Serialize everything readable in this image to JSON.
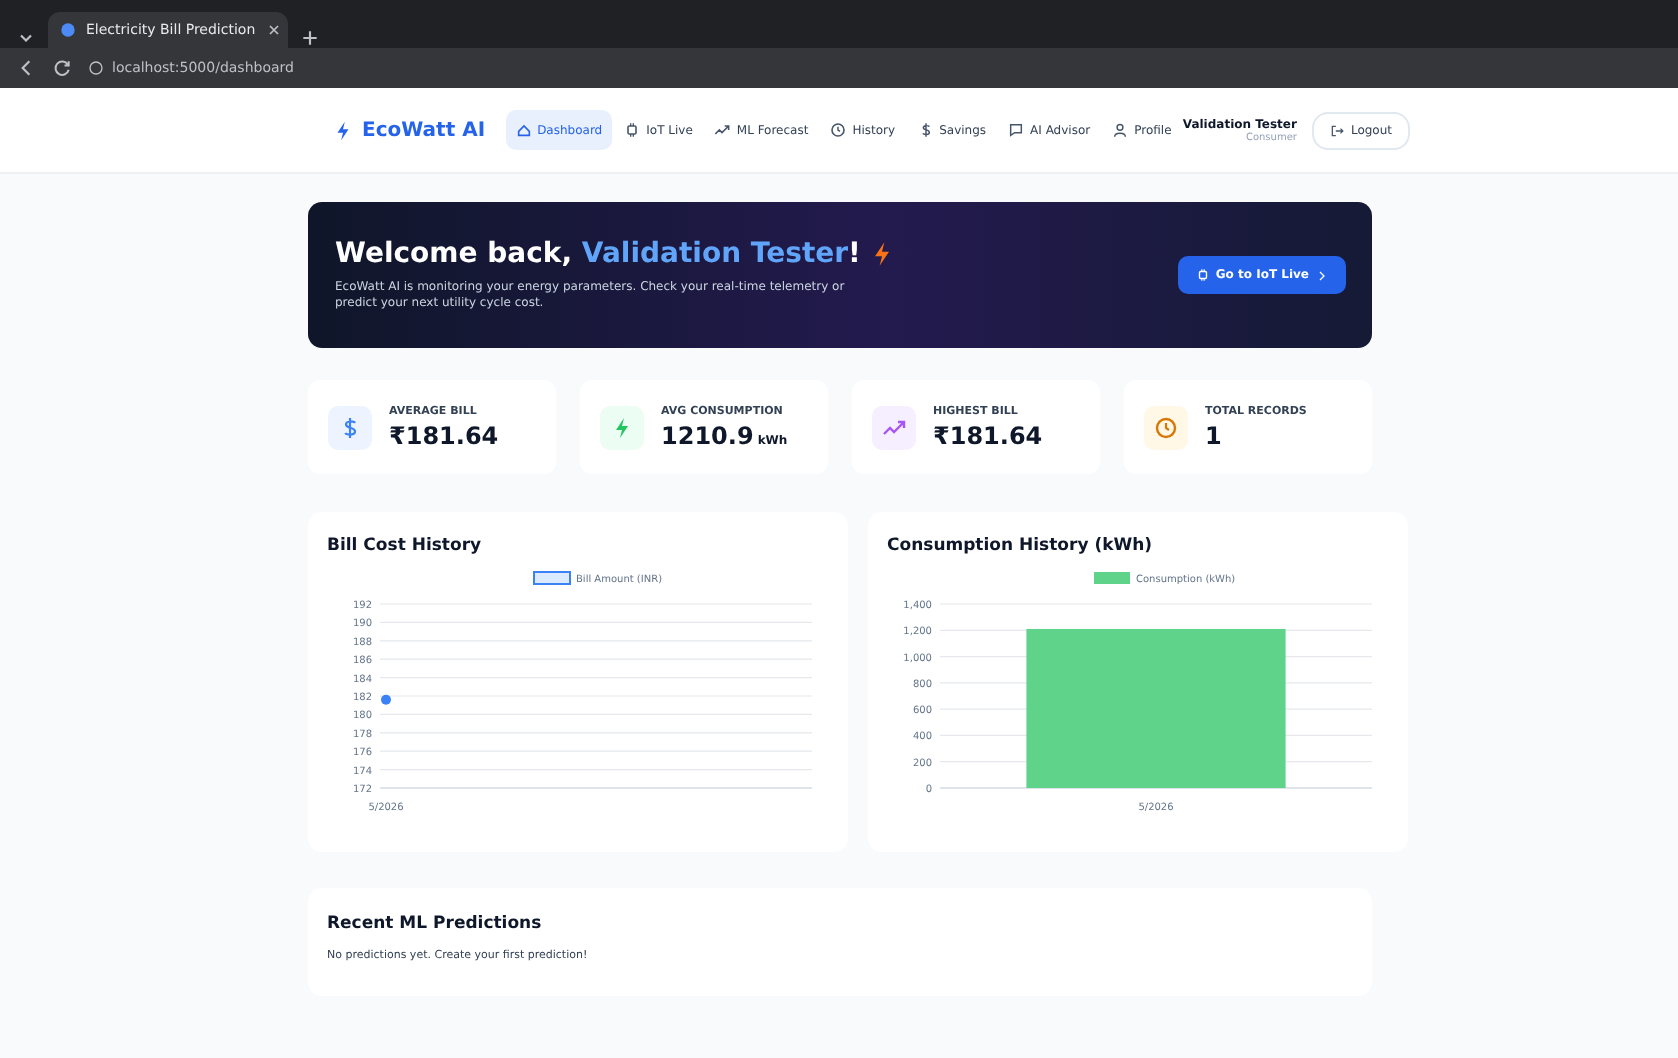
{
  "browser": {
    "tab_title": "Electricity Bill Prediction",
    "url": "localhost:5000/dashboard"
  },
  "header": {
    "logo": "EcoWatt AI",
    "nav": [
      {
        "label": "Dashboard",
        "selected": true
      },
      {
        "label": "IoT Live",
        "selected": false
      },
      {
        "label": "ML Forecast",
        "selected": false
      },
      {
        "label": "History",
        "selected": false
      },
      {
        "label": "Savings",
        "selected": false
      },
      {
        "label": "AI Advisor",
        "selected": false
      },
      {
        "label": "Profile",
        "selected": false
      }
    ],
    "user": {
      "name": "Validation Tester",
      "role": "Consumer"
    },
    "logout": "Logout"
  },
  "banner": {
    "greeting": "Welcome back,",
    "name": "Validation Tester",
    "suffix": "!",
    "text": "EcoWatt AI is monitoring your energy parameters. Check your real-time telemetry or predict your next utility cycle cost.",
    "button": "Go to IoT Live"
  },
  "stats": [
    {
      "kind": "dollar",
      "label": "AVERAGE BILL",
      "value": "₹181.64"
    },
    {
      "kind": "bolt",
      "label": "AVG CONSUMPTION",
      "value": "1210.9",
      "unit": "kWh"
    },
    {
      "kind": "trend",
      "label": "HIGHEST BILL",
      "value": "₹181.64"
    },
    {
      "kind": "clock",
      "label": "TOTAL RECORDS",
      "value": "1"
    }
  ],
  "charts": [
    {
      "title": "Bill Cost History",
      "chart_data": {
        "type": "line",
        "categories": [
          "5/2026"
        ],
        "series": [
          {
            "name": "Bill Amount (INR)",
            "color": "#3b82f6",
            "marker": "circle",
            "values": [
              181.6
            ]
          }
        ],
        "grid": true,
        "ylim": [
          172,
          192
        ],
        "yticks": [
          172,
          174,
          176,
          178,
          180,
          182,
          184,
          186,
          188,
          190,
          192
        ]
      }
    },
    {
      "title": "Consumption History (kWh)",
      "chart_data": {
        "type": "bar",
        "categories": [
          "5/2026"
        ],
        "series": [
          {
            "name": "Consumption (kWh)",
            "color": "#5fd38a",
            "values": [
              1210
            ]
          }
        ],
        "grid": true,
        "ylim": [
          0,
          1400
        ],
        "yticks": [
          0,
          200,
          400,
          600,
          800,
          {
            "value": 1000,
            "label": "1,000"
          },
          {
            "value": 1200,
            "label": "1,200"
          },
          {
            "value": 1400,
            "label": "1,400"
          }
        ]
      }
    }
  ],
  "recent": {
    "title": "Recent ML Predictions",
    "empty": "No predictions yet. Create your first prediction!"
  }
}
